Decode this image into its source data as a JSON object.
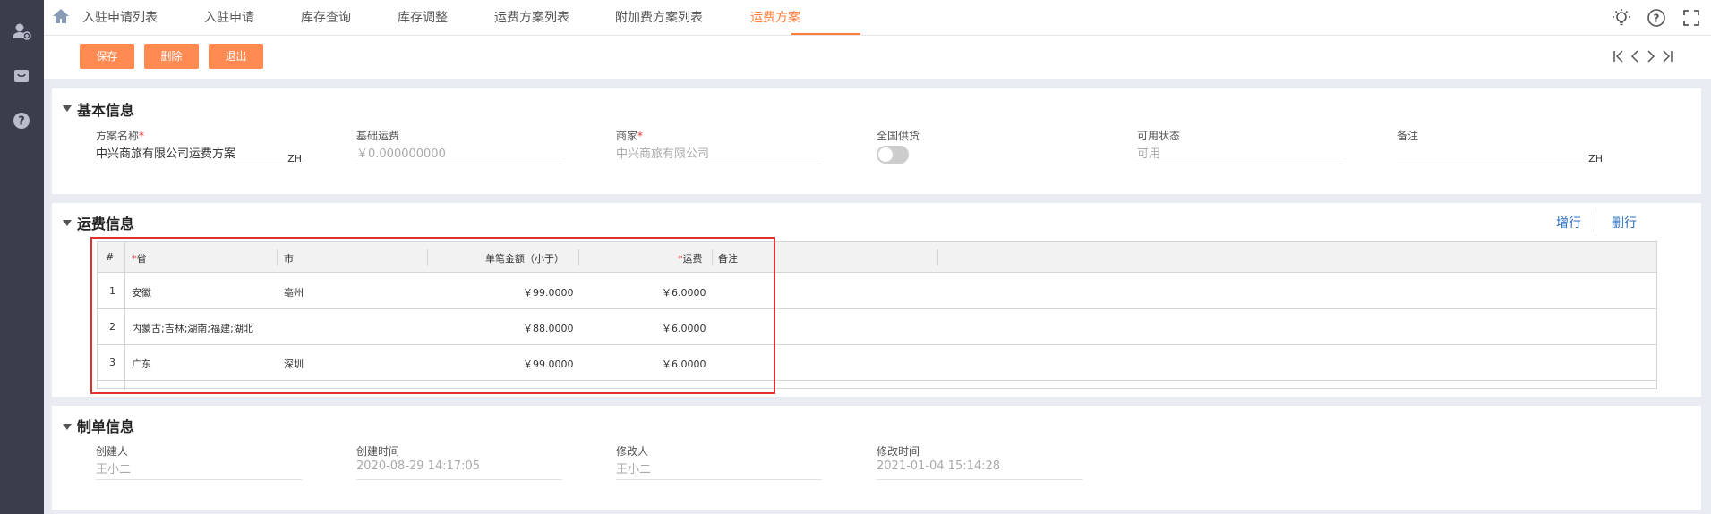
{
  "tabs": [
    {
      "label": "入驻申请列表"
    },
    {
      "label": "入驻申请"
    },
    {
      "label": "库存查询"
    },
    {
      "label": "库存调整"
    },
    {
      "label": "运费方案列表"
    },
    {
      "label": "附加费方案列表"
    },
    {
      "label": "运费方案",
      "active": true
    }
  ],
  "toolbar": {
    "save": "保存",
    "delete": "删除",
    "exit": "退出"
  },
  "basic": {
    "title": "基本信息",
    "plan_name": {
      "label": "方案名称",
      "value": "中兴商旅有限公司运费方案",
      "lang": "ZH"
    },
    "base_freight": {
      "label": "基础运费",
      "value": "￥0.000000000"
    },
    "merchant": {
      "label": "商家",
      "value": "中兴商旅有限公司"
    },
    "nationwide": {
      "label": "全国供货",
      "on": false
    },
    "status": {
      "label": "可用状态",
      "value": "可用"
    },
    "remark": {
      "label": "备注",
      "value": "",
      "lang": "ZH"
    }
  },
  "freight": {
    "title": "运费信息",
    "add_row": "增行",
    "delete_row": "删行",
    "columns": {
      "index": "#",
      "province": "省",
      "city": "市",
      "amount": "单笔金额（小于）",
      "fee": "运费",
      "remark": "备注"
    },
    "rows": [
      {
        "index": "1",
        "province": "安徽",
        "city": "亳州",
        "amount": "￥99.0000",
        "fee": "￥6.0000",
        "remark": ""
      },
      {
        "index": "2",
        "province": "内蒙古;吉林;湖南;福建;湖北",
        "city": "",
        "amount": "￥88.0000",
        "fee": "￥6.0000",
        "remark": ""
      },
      {
        "index": "3",
        "province": "广东",
        "city": "深圳",
        "amount": "￥99.0000",
        "fee": "￥6.0000",
        "remark": ""
      }
    ]
  },
  "billing": {
    "title": "制单信息",
    "creator": {
      "label": "创建人",
      "value": "王小二"
    },
    "created_at": {
      "label": "创建时间",
      "value": "2020-08-29 14:17:05"
    },
    "modifier": {
      "label": "修改人",
      "value": "王小二"
    },
    "modified_at": {
      "label": "修改时间",
      "value": "2021-01-04 15:14:28"
    }
  },
  "colors": {
    "accent": "#ff7c3a",
    "button": "#ff8a52",
    "sidebar": "#3a3d4c",
    "link": "#2a6ebd",
    "highlight": "#e3302f"
  }
}
